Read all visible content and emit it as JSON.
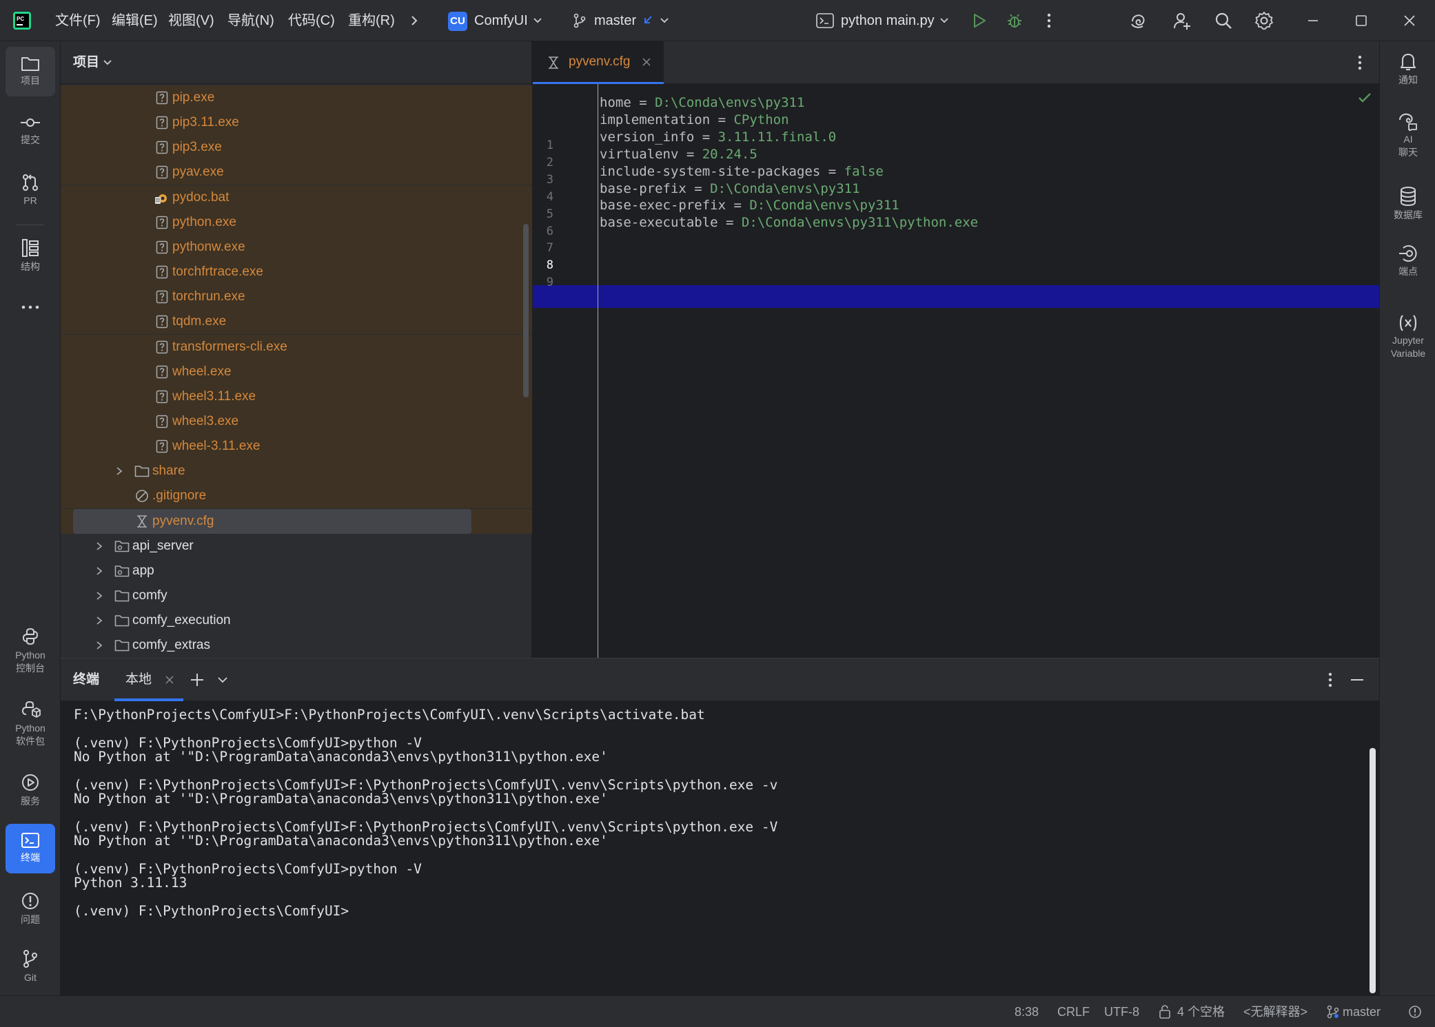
{
  "titlebar": {
    "menus": [
      "文件(F)",
      "编辑(E)",
      "视图(V)",
      "导航(N)",
      "代码(C)",
      "重构(R)"
    ],
    "project_badge": "CU",
    "project_name": "ComfyUI",
    "branch": "master",
    "run_config": "python main.py"
  },
  "left_tools": {
    "project": "项目",
    "commit": "提交",
    "pr": "PR",
    "structure": "结构",
    "python_console_1": "Python",
    "python_console_2": "控制台",
    "python_packages_1": "Python",
    "python_packages_2": "软件包",
    "services": "服务",
    "terminal": "终端",
    "problems": "问题",
    "git": "Git"
  },
  "right_tools": {
    "notifications": "通知",
    "ai_chat_1": "AI",
    "ai_chat_2": "聊天",
    "database": "数据库",
    "endpoints": "端点",
    "jupyter_1": "Jupyter",
    "jupyter_2": "Variable"
  },
  "project_pane": {
    "title": "项目",
    "tree": [
      {
        "name": "pip.exe",
        "kind": "unknown"
      },
      {
        "name": "pip3.11.exe",
        "kind": "unknown"
      },
      {
        "name": "pip3.exe",
        "kind": "unknown"
      },
      {
        "name": "pyav.exe",
        "kind": "unknown"
      },
      {
        "name": "pydoc.bat",
        "kind": "bat"
      },
      {
        "name": "python.exe",
        "kind": "unknown"
      },
      {
        "name": "pythonw.exe",
        "kind": "unknown"
      },
      {
        "name": "torchfrtrace.exe",
        "kind": "unknown"
      },
      {
        "name": "torchrun.exe",
        "kind": "unknown"
      },
      {
        "name": "tqdm.exe",
        "kind": "unknown"
      },
      {
        "name": "transformers-cli.exe",
        "kind": "unknown"
      },
      {
        "name": "wheel.exe",
        "kind": "unknown"
      },
      {
        "name": "wheel3.11.exe",
        "kind": "unknown"
      },
      {
        "name": "wheel3.exe",
        "kind": "unknown"
      },
      {
        "name": "wheel-3.11.exe",
        "kind": "unknown"
      },
      {
        "name": "share",
        "kind": "folder"
      },
      {
        "name": ".gitignore",
        "kind": "ignore"
      },
      {
        "name": "pyvenv.cfg",
        "kind": "cfg"
      },
      {
        "name": "api_server",
        "kind": "package"
      },
      {
        "name": "app",
        "kind": "package"
      },
      {
        "name": "comfy",
        "kind": "folder"
      },
      {
        "name": "comfy_execution",
        "kind": "folder"
      },
      {
        "name": "comfy_extras",
        "kind": "folder"
      }
    ]
  },
  "editor": {
    "tab_name": "pyvenv.cfg",
    "lines": [
      {
        "num": "1",
        "key": "home",
        "value": "D:\\Conda\\envs\\py311"
      },
      {
        "num": "2",
        "key": "implementation",
        "value": "CPython"
      },
      {
        "num": "3",
        "key": "version_info",
        "value": "3.11.11.final.0"
      },
      {
        "num": "4",
        "key": "virtualenv",
        "value": "20.24.5"
      },
      {
        "num": "5",
        "key": "include-system-site-packages",
        "value": "false"
      },
      {
        "num": "6",
        "key": "base-prefix",
        "value": "D:\\Conda\\envs\\py311"
      },
      {
        "num": "7",
        "key": "base-exec-prefix",
        "value": "D:\\Conda\\envs\\py311"
      },
      {
        "num": "8",
        "key": "base-executable",
        "value": "D:\\Conda\\envs\\py311\\python.exe"
      },
      {
        "num": "9",
        "key": "",
        "value": ""
      }
    ],
    "current_line": "8"
  },
  "terminal": {
    "title": "终端",
    "tab": "本地",
    "lines": [
      "F:\\PythonProjects\\ComfyUI>F:\\PythonProjects\\ComfyUI\\.venv\\Scripts\\activate.bat",
      "",
      "(.venv) F:\\PythonProjects\\ComfyUI>python -V",
      "No Python at '\"D:\\ProgramData\\anaconda3\\envs\\python311\\python.exe'",
      "",
      "(.venv) F:\\PythonProjects\\ComfyUI>F:\\PythonProjects\\ComfyUI\\.venv\\Scripts\\python.exe -v",
      "No Python at '\"D:\\ProgramData\\anaconda3\\envs\\python311\\python.exe'",
      "",
      "(.venv) F:\\PythonProjects\\ComfyUI>F:\\PythonProjects\\ComfyUI\\.venv\\Scripts\\python.exe -V",
      "No Python at '\"D:\\ProgramData\\anaconda3\\envs\\python311\\python.exe'",
      "",
      "(.venv) F:\\PythonProjects\\ComfyUI>python -V",
      "Python 3.11.13",
      "",
      "(.venv) F:\\PythonProjects\\ComfyUI>"
    ]
  },
  "statusbar": {
    "position": "8:38",
    "line_sep": "CRLF",
    "encoding": "UTF-8",
    "indent": "4 个空格",
    "interpreter": "<无解释器>",
    "branch": "master"
  },
  "colors": {
    "accent": "#3574f0",
    "ignored_file": "#d5883e",
    "value_green": "#6aab73",
    "current_line": "#171594"
  }
}
